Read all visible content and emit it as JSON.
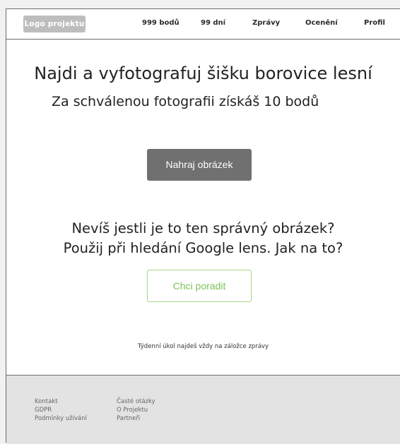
{
  "header": {
    "logo": "Logo projektu",
    "nav": [
      "999 bodů",
      "99 dní",
      "Zprávy",
      "Ocenění",
      "Profil"
    ]
  },
  "main": {
    "title": "Najdi a vyfotografuj šišku borovice lesní",
    "subtitle": "Za schválenou fotografii získáš 10 bodů",
    "upload_button": "Nahraj obrázek",
    "question_line1": "Nevíš jestli je to ten správný obrázek?",
    "question_line2": "Použij při hledání Google lens. Jak na to?",
    "advise_button": "Chci poradit",
    "hint": "Týdenní úkol najdeš vždy na záložce zprávy"
  },
  "footer": {
    "col1": [
      "Kontakt",
      "GDPR",
      "Podmínky užívání"
    ],
    "col2": [
      "Časté otázky",
      "O Projektu",
      "Partneři"
    ]
  },
  "colors": {
    "upload_button_bg": "#707070",
    "advise_button_border": "#a6d98a",
    "advise_button_text": "#7cc35a",
    "footer_bg": "#e3e3e3",
    "logo_bg": "#bdbdbd"
  }
}
